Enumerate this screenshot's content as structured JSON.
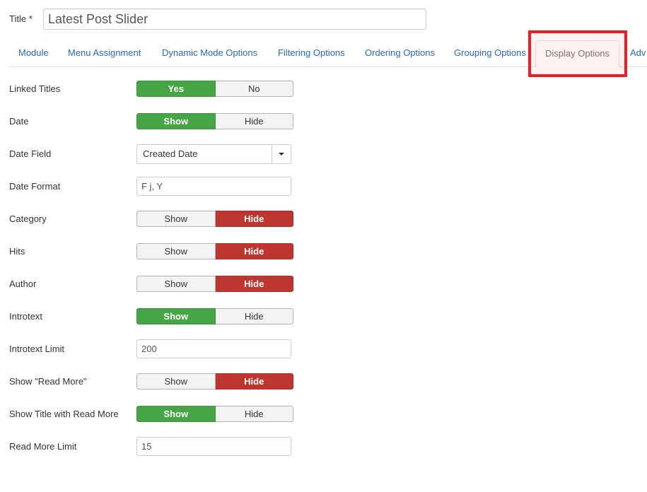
{
  "title_field": {
    "label": "Title *",
    "value": "Latest Post Slider"
  },
  "tabs": [
    {
      "label": "Module",
      "active": false
    },
    {
      "label": "Menu Assignment",
      "active": false
    },
    {
      "label": "Dynamic Mode Options",
      "active": false
    },
    {
      "label": "Filtering Options",
      "active": false
    },
    {
      "label": "Ordering Options",
      "active": false
    },
    {
      "label": "Grouping Options",
      "active": false
    },
    {
      "label": "Display Options",
      "active": true
    },
    {
      "label": "Adv",
      "active": false
    }
  ],
  "fields": {
    "linked_titles": {
      "label": "Linked Titles",
      "options": [
        "Yes",
        "No"
      ],
      "selected": "Yes",
      "selected_color": "green"
    },
    "date": {
      "label": "Date",
      "options": [
        "Show",
        "Hide"
      ],
      "selected": "Show",
      "selected_color": "green"
    },
    "date_field": {
      "label": "Date Field",
      "value": "Created Date"
    },
    "date_format": {
      "label": "Date Format",
      "value": "F j, Y"
    },
    "category": {
      "label": "Category",
      "options": [
        "Show",
        "Hide"
      ],
      "selected": "Hide",
      "selected_color": "red"
    },
    "hits": {
      "label": "Hits",
      "options": [
        "Show",
        "Hide"
      ],
      "selected": "Hide",
      "selected_color": "red"
    },
    "author": {
      "label": "Author",
      "options": [
        "Show",
        "Hide"
      ],
      "selected": "Hide",
      "selected_color": "red"
    },
    "introtext": {
      "label": "Introtext",
      "options": [
        "Show",
        "Hide"
      ],
      "selected": "Show",
      "selected_color": "green"
    },
    "introtext_limit": {
      "label": "Introtext Limit",
      "value": "200"
    },
    "show_read_more": {
      "label": "Show \"Read More\"",
      "options": [
        "Show",
        "Hide"
      ],
      "selected": "Hide",
      "selected_color": "red"
    },
    "show_title_with_read_more": {
      "label": "Show Title with Read More",
      "options": [
        "Show",
        "Hide"
      ],
      "selected": "Show",
      "selected_color": "green"
    },
    "read_more_limit": {
      "label": "Read More Limit",
      "value": "15"
    }
  },
  "colors": {
    "toggle_green": "#46a546",
    "toggle_red": "#bd362f",
    "tab_link": "#2a69b8",
    "highlight_border": "#ee1c24"
  }
}
